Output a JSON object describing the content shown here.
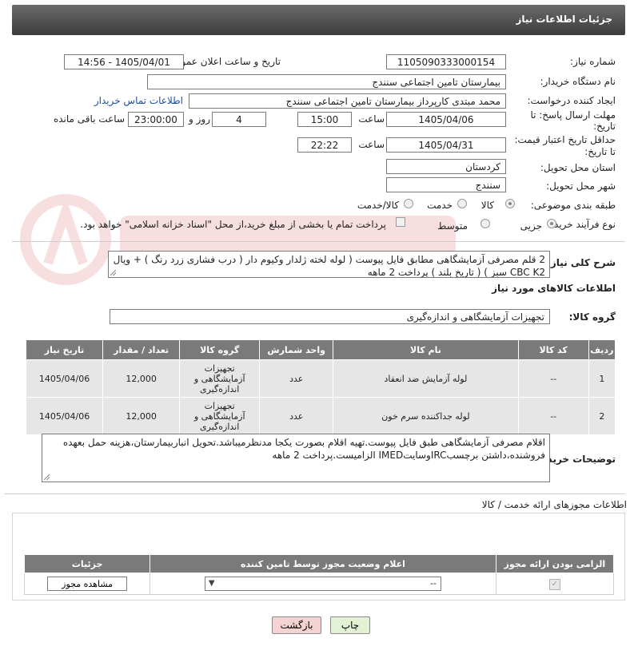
{
  "header": {
    "title": "جزئیات اطلاعات نیاز"
  },
  "form": {
    "need_number_label": "شماره نیاز:",
    "need_number": "1105090333000154",
    "announce_label": "تاریخ و ساعت اعلان عمومی:",
    "announce_value": "1405/04/01 - 14:56",
    "buyer_org_label": "نام دستگاه خریدار:",
    "buyer_org": "بیمارستان تامین اجتماعی سنندج",
    "creator_label": "ایجاد کننده درخواست:",
    "creator": "محمد مبتدی کارپرداز بیمارستان تامین اجتماعی سنندج",
    "contact_link": "اطلاعات تماس خریدار",
    "reply_deadline_label_1": "مهلت ارسال پاسخ: تا",
    "reply_deadline_label_2": "تاریخ:",
    "reply_date": "1405/04/06",
    "time_label": "ساعت",
    "reply_time": "15:00",
    "days_value": "4",
    "days_label": "روز و",
    "remaining_time": "23:00:00",
    "remaining_label": "ساعت باقی مانده",
    "price_validity_label_1": "حداقل تاریخ اعتبار قیمت:",
    "price_validity_label_2": "تا تاریخ:",
    "price_date": "1405/04/31",
    "price_time_label": "ساعت",
    "price_time": "22:22",
    "province_label": "استان محل تحویل:",
    "province": "کردستان",
    "city_label": "شهر محل تحویل:",
    "city": "سنندج",
    "category_label": "طبقه بندی موضوعی:",
    "category_options": [
      "کالا",
      "خدمت",
      "کالا/خدمت"
    ],
    "process_label": "نوع فرآیند خرید :",
    "process_options": [
      "جزیی",
      "متوسط"
    ],
    "payment_note": "پرداخت تمام یا بخشی از مبلغ خرید،از محل \"اسناد خزانه اسلامی\" خواهد بود."
  },
  "description": {
    "label": "شرح کلی نیاز:",
    "text": "2 قلم مصرفی آزمایشگاهی مطابق فایل پیوست ( لوله لخته ژلدار وکیوم دار ( درب فشاری زرد رنگ ) + ویال CBC K2 سبز ) ( تاریخ بلند ) پرداخت 2 ماهه"
  },
  "goods": {
    "section_title": "اطلاعات کالاهای مورد نیاز",
    "group_label": "گروه کالا:",
    "group_value": "تجهیزات آزمایشگاهی و اندازه‌گیری",
    "columns": [
      "ردیف",
      "کد کالا",
      "نام کالا",
      "واحد شمارش",
      "گروه کالا",
      "تعداد / مقدار",
      "تاریخ نیاز"
    ],
    "rows": [
      [
        "1",
        "--",
        "لوله آزمایش ضد انعقاد",
        "عدد",
        "تجهیزات آزمایشگاهی و اندازه‌گیری",
        "12,000",
        "1405/04/06"
      ],
      [
        "2",
        "--",
        "لوله جداکننده سرم خون",
        "عدد",
        "تجهیزات آزمایشگاهی و اندازه‌گیری",
        "12,000",
        "1405/04/06"
      ]
    ]
  },
  "buyer_notes": {
    "label": "توضیحات خریدار:",
    "text": "اقلام مصرفی آزمایشگاهی طبق فایل پیوست.تهیه اقلام بصورت یکجا مدنظرمیباشد.تحویل انباربیمارستان،هزینه حمل بعهده فروشنده،داشتن برچسبIRCوسایتIMED الزامیست.پرداخت 2 ماهه"
  },
  "licenses": {
    "section_title": "اطلاعات مجوزهای ارائه خدمت / کالا",
    "columns": [
      "الزامی بودن ارائه مجوز",
      "اعلام وضعیت مجوز توسط تامین کننده",
      "جزئیات"
    ],
    "select_value": "--",
    "view_button": "مشاهده مجوز"
  },
  "footer": {
    "print_button": "چاپ",
    "back_button": "بازگشت"
  },
  "colors": {
    "header_bg": "#4a4a4a",
    "table_header_bg": "#7a7a7a",
    "row_bg": "#e6e6e6",
    "link": "#1a4ea8",
    "back_button_bg": "#f6d3d3",
    "print_button_bg": "#e3f2d5"
  }
}
